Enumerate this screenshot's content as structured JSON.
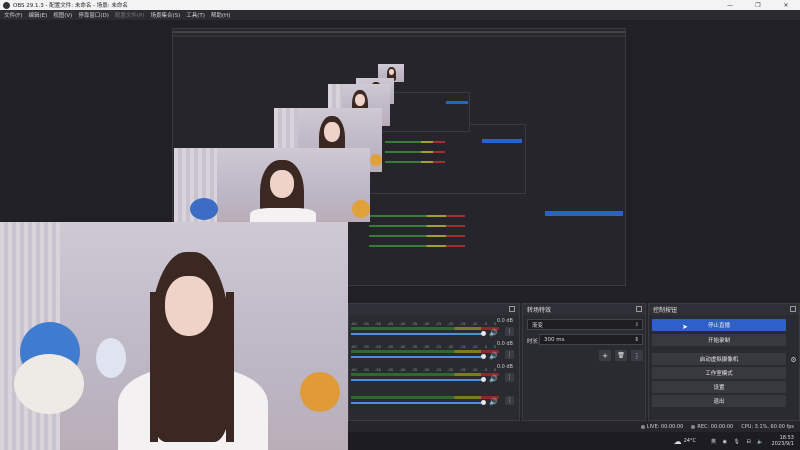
{
  "window": {
    "title": "OBS 29.1.3 - 配置文件: 未命名 - 场景: 未命名",
    "controls": [
      "—",
      "❐",
      "✕"
    ]
  },
  "menubar": {
    "items": [
      {
        "label": "文件(F)",
        "enabled": true
      },
      {
        "label": "编辑(E)",
        "enabled": true
      },
      {
        "label": "视图(V)",
        "enabled": true
      },
      {
        "label": "停靠窗口(D)",
        "enabled": true
      },
      {
        "label": "配置文件(P)",
        "enabled": false
      },
      {
        "label": "场景集合(S)",
        "enabled": true
      },
      {
        "label": "工具(T)",
        "enabled": true
      },
      {
        "label": "帮助(H)",
        "enabled": true
      }
    ]
  },
  "mixer": {
    "rows": [
      {
        "db": "0.0 dB"
      },
      {
        "db": "0.0 dB"
      },
      {
        "db": "0.0 dB"
      }
    ],
    "ticks": [
      "-60",
      "-55",
      "-50",
      "-45",
      "-40",
      "-35",
      "-30",
      "-25",
      "-20",
      "-15",
      "-10",
      "-5",
      "0"
    ]
  },
  "transitions": {
    "title": "转场特效",
    "selected": "渐变",
    "duration_label": "时长",
    "duration_value": "300 ms",
    "add": "+",
    "remove": "🗑",
    "more": "⋮"
  },
  "controls": {
    "title": "控制按钮",
    "stop_stream": "停止直播",
    "start_record": "开始录制",
    "virtual_cam": "启动虚拟摄像机",
    "studio_mode": "工作室模式",
    "settings": "设置",
    "exit": "退出"
  },
  "status": {
    "live": "LIVE: 00:00:00",
    "rec": "REC: 00:00:00",
    "cpu": "CPU: 3.1%, 60.00 fps"
  },
  "taskbar": {
    "temperature": "24°C",
    "ime": "英",
    "time": "18:53",
    "date": "2023/9/1"
  },
  "colors": {
    "accent": "#2f5fc9",
    "panel": "#2a2a31",
    "background": "#1f1f24"
  }
}
